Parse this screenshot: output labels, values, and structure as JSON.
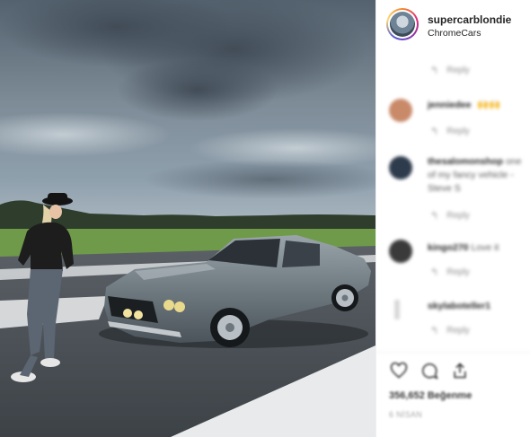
{
  "post": {
    "image": {
      "subject": "photo-woman-with-grey-mustang",
      "colors": {
        "sky": "#5b6a78",
        "grass": "#6f9a4a",
        "tarmac": "#4a4f55",
        "car": "#7a858c"
      }
    },
    "header": {
      "username": "supercarblondie",
      "location": "ChromeCars"
    },
    "comments": [
      {
        "kind": "reply-meta",
        "reply_label": "Reply"
      },
      {
        "kind": "comment",
        "author": "jenniedee",
        "text": "",
        "likes_label": "",
        "reply_label": "Reply",
        "avatar_color": "#c98a6a"
      },
      {
        "kind": "comment",
        "author": "thesalomonshop",
        "text": "one of my fancy vehicle - Steve S",
        "reply_label": "Reply",
        "avatar_color": "#2e3b4c"
      },
      {
        "kind": "comment",
        "author": "kingo270",
        "text": "Love it",
        "reply_label": "Reply",
        "avatar_color": "#3a3a3a"
      },
      {
        "kind": "comment",
        "author": "skylaboteller1",
        "text": "",
        "reply_label": "Reply",
        "avatar_color": "#d8d8d8"
      }
    ],
    "actions": {
      "like": "heart-icon",
      "comment": "comment-bubble-icon",
      "share": "share-icon"
    },
    "likes": "356,652 Beğenme",
    "date": "6 NİSAN"
  }
}
